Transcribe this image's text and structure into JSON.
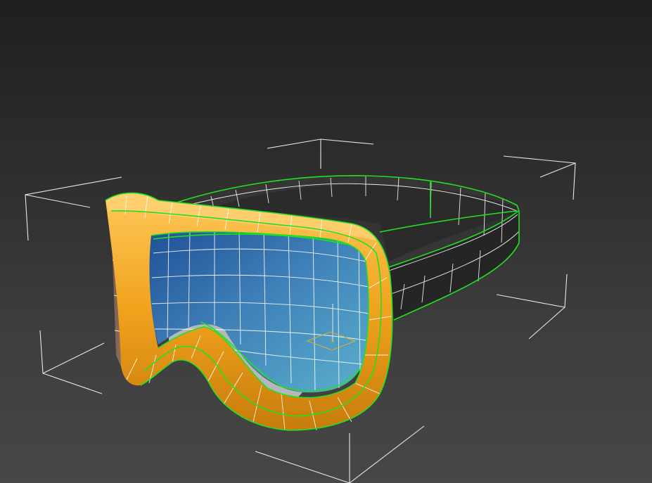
{
  "viewport": {
    "view": "perspective",
    "shading": "default-shading-with-edged-faces",
    "background": "#2e2e2e"
  },
  "scene": {
    "object": "ski-goggles",
    "selected": true,
    "selection_edge_color": "#22e022",
    "wireframe_color": "#ffffff",
    "bounding_box_color": "#e8e8e8",
    "pivot_gizmo_color": "#e0b030",
    "materials": {
      "frame": "#f0a21c",
      "lens": "#3e7fb8",
      "strap": "#262626"
    }
  }
}
